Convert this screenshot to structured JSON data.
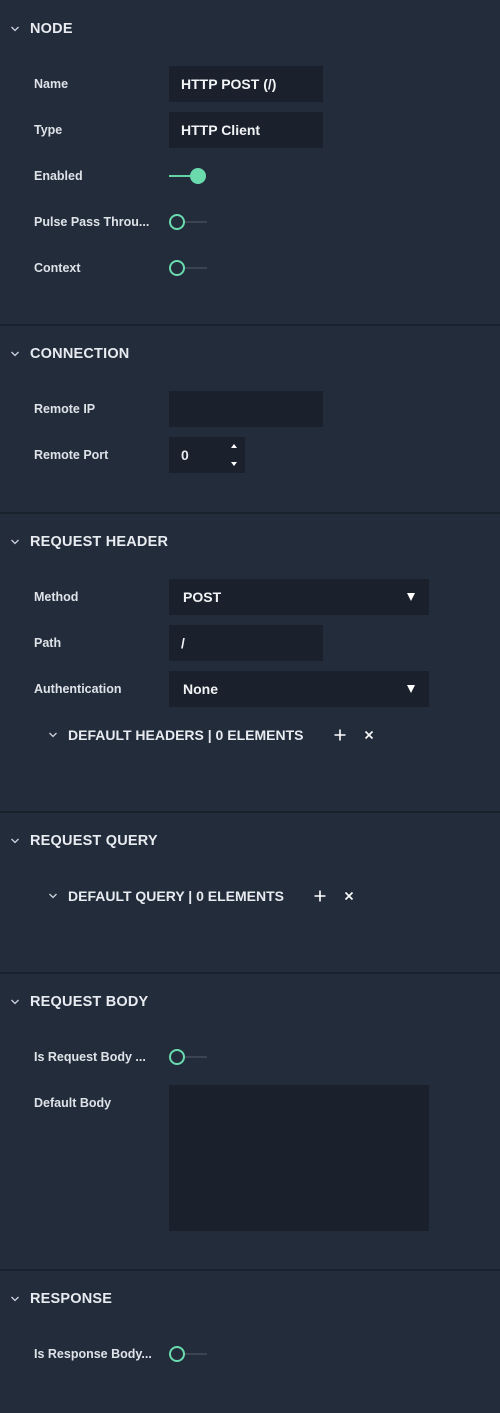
{
  "node": {
    "title": "NODE",
    "fields": {
      "name_label": "Name",
      "name_value": "HTTP POST (/)",
      "type_label": "Type",
      "type_value": "HTTP Client",
      "enabled_label": "Enabled",
      "enabled_on": true,
      "pulse_label": "Pulse Pass Throu...",
      "pulse_on": false,
      "context_label": "Context",
      "context_on": false
    }
  },
  "connection": {
    "title": "CONNECTION",
    "remote_ip_label": "Remote IP",
    "remote_ip_value": "",
    "remote_port_label": "Remote Port",
    "remote_port_value": "0"
  },
  "request_header": {
    "title": "REQUEST HEADER",
    "method_label": "Method",
    "method_value": "POST",
    "path_label": "Path",
    "path_value": "/",
    "auth_label": "Authentication",
    "auth_value": "None",
    "default_headers_title": "DEFAULT HEADERS | 0 ELEMENTS"
  },
  "request_query": {
    "title": "REQUEST QUERY",
    "default_query_title": "DEFAULT QUERY | 0 ELEMENTS"
  },
  "request_body": {
    "title": "REQUEST BODY",
    "is_body_label": "Is Request Body ...",
    "is_body_on": false,
    "default_body_label": "Default Body",
    "default_body_value": ""
  },
  "response": {
    "title": "RESPONSE",
    "is_body_label": "Is Response Body...",
    "is_body_on": false
  },
  "colors": {
    "background": "#222c3b",
    "field": "#1a212c",
    "accent": "#6bdbae",
    "divider": "#19212d"
  },
  "icons": {
    "collapse": "chevron-down-icon",
    "add": "plus-icon",
    "clear": "close-icon"
  }
}
